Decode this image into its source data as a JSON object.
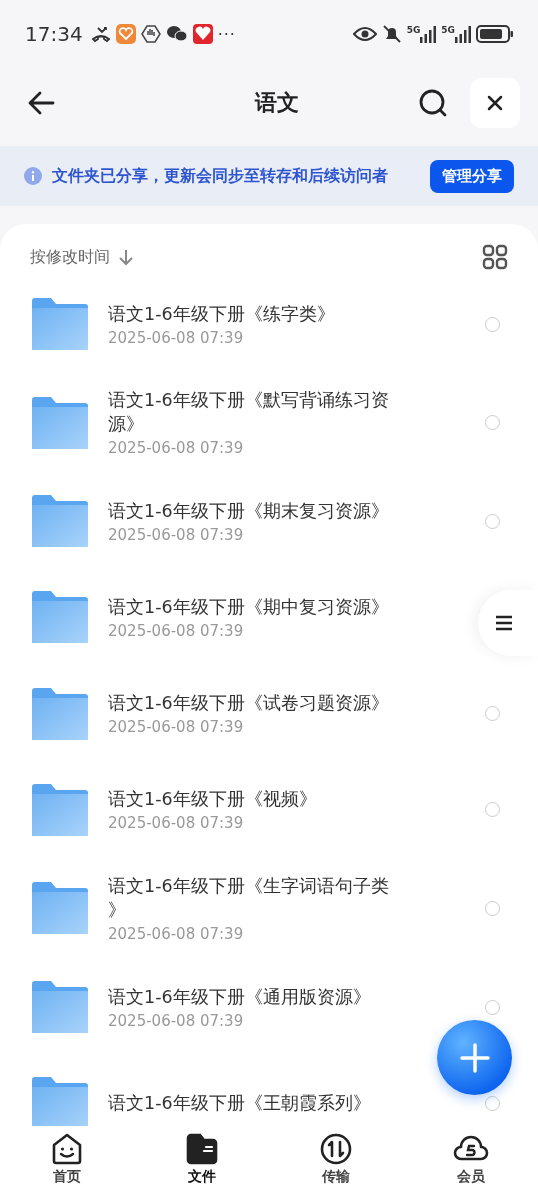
{
  "status_bar": {
    "time": "17:34",
    "more": "···",
    "network_labels": [
      "5G",
      "5G"
    ]
  },
  "header": {
    "title": "语文"
  },
  "notice": {
    "text": "文件夹已分享，更新会同步至转存和后续访问者",
    "button": "管理分享"
  },
  "sort": {
    "label": "按修改时间"
  },
  "files": [
    {
      "name": "语文1-6年级下册《练字类》",
      "date": "2025-06-08 07:39",
      "selected": false
    },
    {
      "name": "语文1-6年级下册《默写背诵练习资源》",
      "date": "2025-06-08 07:39",
      "selected": false
    },
    {
      "name": "语文1-6年级下册《期末复习资源》",
      "date": "2025-06-08 07:39",
      "selected": false
    },
    {
      "name": "语文1-6年级下册《期中复习资源》",
      "date": "2025-06-08 07:39"
    },
    {
      "name": "语文1-6年级下册《试卷习题资源》",
      "date": "2025-06-08 07:39",
      "selected": false
    },
    {
      "name": "语文1-6年级下册《视频》",
      "date": "2025-06-08 07:39",
      "selected": false
    },
    {
      "name": "语文1-6年级下册《生字词语句子类》",
      "date": "2025-06-08 07:39",
      "selected": false
    },
    {
      "name": "语文1-6年级下册《通用版资源》",
      "date": "2025-06-08 07:39",
      "selected": false
    },
    {
      "name": "语文1-6年级下册《王朝霞系列》",
      "selected": false
    }
  ],
  "tabs": [
    {
      "label": "首页",
      "kind": "home",
      "selected": false
    },
    {
      "label": "文件",
      "kind": "files",
      "selected": true
    },
    {
      "label": "传输",
      "kind": "transfer",
      "selected": false
    },
    {
      "label": "会员",
      "kind": "cloud",
      "selected": false
    }
  ]
}
